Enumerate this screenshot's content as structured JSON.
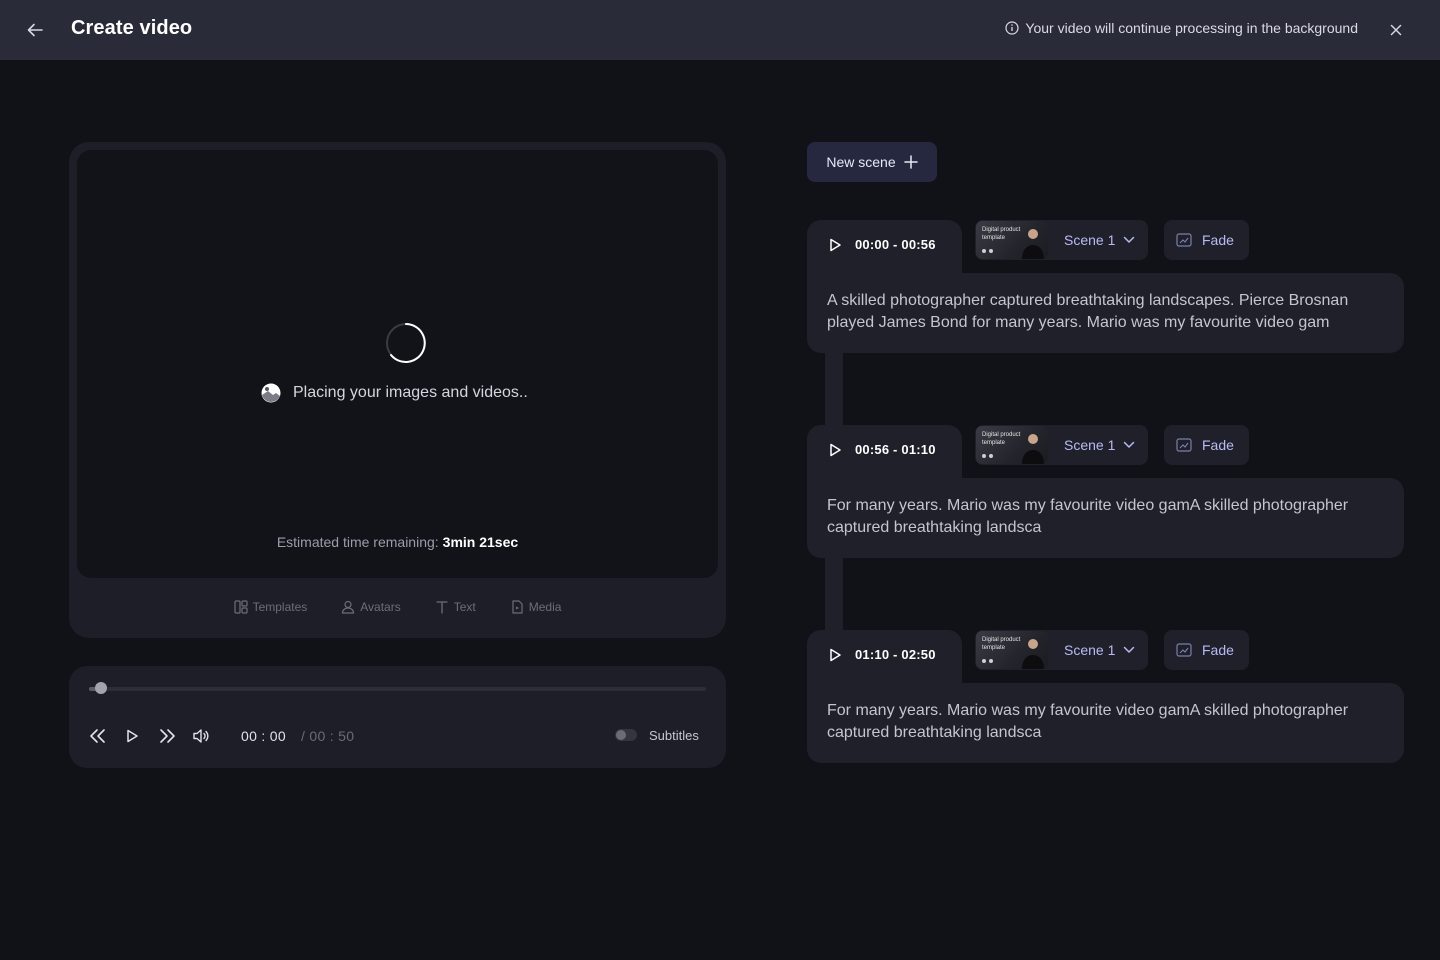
{
  "header": {
    "title": "Create video",
    "notice": "Your video will continue processing in the background"
  },
  "preview": {
    "loading_text": "Placing your images and videos..",
    "eta_label": "Estimated time remaining:",
    "eta_value": "3min 21sec",
    "tools": [
      {
        "label": "Templates",
        "icon": "templates-icon"
      },
      {
        "label": "Avatars",
        "icon": "avatar-icon"
      },
      {
        "label": "Text",
        "icon": "text-icon"
      },
      {
        "label": "Media",
        "icon": "media-icon"
      }
    ]
  },
  "player": {
    "current_time": "00 : 00",
    "total_time": "/  00 : 50",
    "progress": 0.02,
    "subtitles_label": "Subtitles",
    "subtitles_on": false
  },
  "new_scene_label": "New scene",
  "scenes": [
    {
      "time_range": "00:00 - 00:56",
      "template_text": "Digital product template",
      "scene_label": "Scene 1",
      "transition": "Fade",
      "text": "A skilled photographer captured breathtaking landscapes. Pierce Brosnan played James Bond for many years. Mario was my favourite video gam"
    },
    {
      "time_range": "00:56 - 01:10",
      "template_text": "Digital product template",
      "scene_label": "Scene 1",
      "transition": "Fade",
      "text": "For many years. Mario was my favourite video gamA skilled photographer captured breathtaking landsca"
    },
    {
      "time_range": "01:10 - 02:50",
      "template_text": "Digital product template",
      "scene_label": "Scene 1",
      "transition": "Fade",
      "text": "For many years. Mario was my favourite video gamA skilled photographer captured breathtaking landsca"
    }
  ],
  "colors": {
    "background": "#111217",
    "header": "#2a2b38",
    "card": "#1d1e27",
    "accent": "#b7bbf5"
  }
}
